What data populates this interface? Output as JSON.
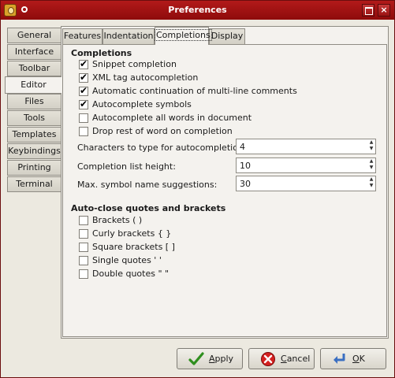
{
  "window": {
    "title": "Preferences"
  },
  "left_tabs": [
    "General",
    "Interface",
    "Toolbar",
    "Editor",
    "Files",
    "Tools",
    "Templates",
    "Keybindings",
    "Printing",
    "Terminal"
  ],
  "active_left_tab": "Editor",
  "inner_tabs": [
    "Features",
    "Indentation",
    "Completions",
    "Display"
  ],
  "active_inner_tab": "Completions",
  "completions": {
    "heading": "Completions",
    "options": [
      {
        "label": "Snippet completion",
        "checked": true
      },
      {
        "label": "XML tag autocompletion",
        "checked": true
      },
      {
        "label": "Automatic continuation of multi-line comments",
        "checked": true
      },
      {
        "label": "Autocomplete symbols",
        "checked": true
      },
      {
        "label": "Autocomplete all words in document",
        "checked": false
      },
      {
        "label": "Drop rest of word on completion",
        "checked": false
      }
    ],
    "spins": [
      {
        "label": "Characters to type for autocompletion:",
        "value": "4"
      },
      {
        "label": "Completion list height:",
        "value": "10"
      },
      {
        "label": "Max. symbol name suggestions:",
        "value": "30"
      }
    ]
  },
  "autoclose": {
    "heading": "Auto-close quotes and brackets",
    "options": [
      {
        "label": "Brackets ( )",
        "checked": false
      },
      {
        "label": "Curly brackets { }",
        "checked": false
      },
      {
        "label": "Square brackets [ ]",
        "checked": false
      },
      {
        "label": "Single quotes ' '",
        "checked": false
      },
      {
        "label": "Double quotes \" \"",
        "checked": false
      }
    ]
  },
  "buttons": {
    "apply": {
      "label": "Apply",
      "mnemonic": "A",
      "rest": "pply"
    },
    "cancel": {
      "label": "Cancel",
      "mnemonic": "C",
      "rest": "ancel"
    },
    "ok": {
      "label": "OK",
      "mnemonic": "O",
      "rest": "K"
    }
  },
  "colors": {
    "titlebar": "#a31515",
    "panel": "#f4f2ee",
    "background": "#ece9e0"
  }
}
